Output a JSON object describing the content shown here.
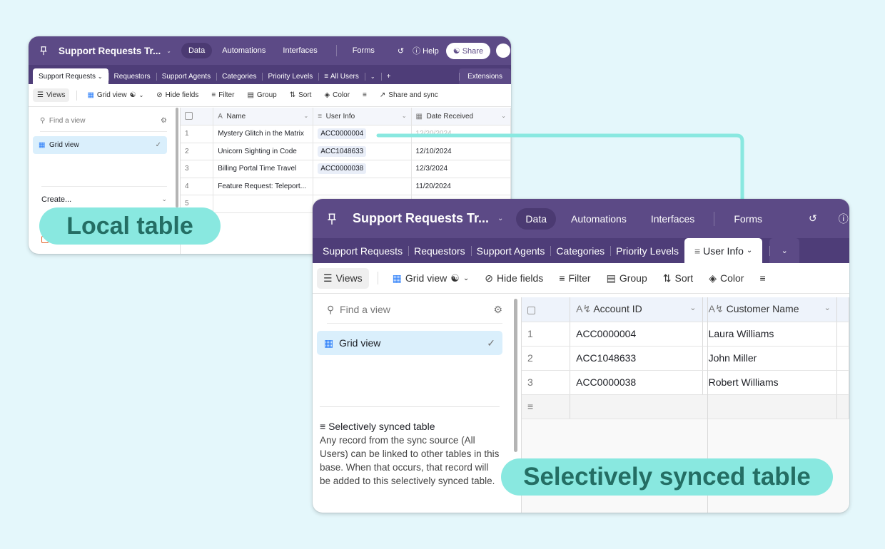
{
  "accent_colors": {
    "header_purple": "#5c4a86",
    "tabbar_purple": "#4e3d78",
    "callout_teal": "#89e8e0",
    "callout_text": "#246e64",
    "selected_view_bg": "#daeffc"
  },
  "local_window": {
    "base_title": "Support Requests Tr...",
    "nav_tabs": [
      "Data",
      "Automations",
      "Interfaces",
      "Forms"
    ],
    "active_nav": "Data",
    "help_label": "Help",
    "share_label": "Share",
    "tables": [
      "Support Requests",
      "Requestors",
      "Support Agents",
      "Categories",
      "Priority Levels",
      "All Users"
    ],
    "active_table": "Support Requests",
    "extensions_label": "Extensions",
    "toolbar": {
      "views": "Views",
      "grid_view": "Grid view",
      "hide_fields": "Hide fields",
      "filter": "Filter",
      "group": "Group",
      "sort": "Sort",
      "color": "Color",
      "share_sync": "Share and sync"
    },
    "sidebar": {
      "find_placeholder": "Find a view",
      "view_name": "Grid view",
      "create_label": "Create..."
    },
    "columns": [
      "Name",
      "User Info",
      "Date Received"
    ],
    "rows": [
      {
        "num": "1",
        "name": "Mystery Glitch in the Matrix",
        "user_info": "ACC0000004",
        "date": "12/20/2024"
      },
      {
        "num": "2",
        "name": "Unicorn Sighting in Code",
        "user_info": "ACC1048633",
        "date": "12/10/2024"
      },
      {
        "num": "3",
        "name": "Billing Portal Time Travel",
        "user_info": "ACC0000038",
        "date": "12/3/2024"
      },
      {
        "num": "4",
        "name": "Feature Request: Teleport...",
        "user_info": "",
        "date": "11/20/2024"
      },
      {
        "num": "5",
        "name": "",
        "user_info": "",
        "date": ""
      }
    ]
  },
  "synced_window": {
    "base_title": "Support Requests Tr...",
    "nav_tabs": [
      "Data",
      "Automations",
      "Interfaces",
      "Forms"
    ],
    "active_nav": "Data",
    "tables": [
      "Support Requests",
      "Requestors",
      "Support Agents",
      "Categories",
      "Priority Levels",
      "User Info"
    ],
    "active_table": "User Info",
    "toolbar": {
      "views": "Views",
      "grid_view": "Grid view",
      "hide_fields": "Hide fields",
      "filter": "Filter",
      "group": "Group",
      "sort": "Sort",
      "color": "Color"
    },
    "sidebar": {
      "find_placeholder": "Find a view",
      "view_name": "Grid view",
      "info_title": "Selectively synced table",
      "info_text": "Any record from the sync source (All Users) can be linked to other tables in this base. When that occurs, that record will be added to this selectively synced table."
    },
    "columns": [
      "Account ID",
      "Customer Name"
    ],
    "rows": [
      {
        "num": "1",
        "account_id": "ACC0000004",
        "customer_name": "Laura Williams"
      },
      {
        "num": "2",
        "account_id": "ACC1048633",
        "customer_name": "John Miller"
      },
      {
        "num": "3",
        "account_id": "ACC0000038",
        "customer_name": "Robert Williams"
      }
    ]
  },
  "callouts": {
    "local": "Local table",
    "synced": "Selectively synced table"
  }
}
